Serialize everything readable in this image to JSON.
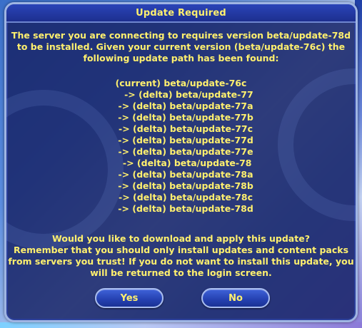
{
  "dialog": {
    "title": "Update Required",
    "message": [
      "The server you are connecting to requires version beta/update-78d",
      "to be installed. Given your current version (beta/update-76c) the",
      "following update path has been found:"
    ],
    "update_path": [
      "(current) beta/update-76c",
      "     -> (delta) beta/update-77",
      "   -> (delta) beta/update-77a",
      "   -> (delta) beta/update-77b",
      "   -> (delta) beta/update-77c",
      "   -> (delta) beta/update-77d",
      "   -> (delta) beta/update-77e",
      "    -> (delta) beta/update-78",
      "   -> (delta) beta/update-78a",
      "   -> (delta) beta/update-78b",
      "   -> (delta) beta/update-78c",
      "   -> (delta) beta/update-78d"
    ],
    "question": [
      "Would you like to download and apply this update?",
      "Remember that you should only install updates and content packs",
      "from servers you trust! If you do not want to install this update, you",
      "will be returned to the login screen."
    ],
    "buttons": {
      "yes_label": "Yes",
      "no_label": "No"
    }
  },
  "colors": {
    "text": "#fff06e",
    "dialog_bg": "#172468",
    "border": "#9fb5e3"
  }
}
